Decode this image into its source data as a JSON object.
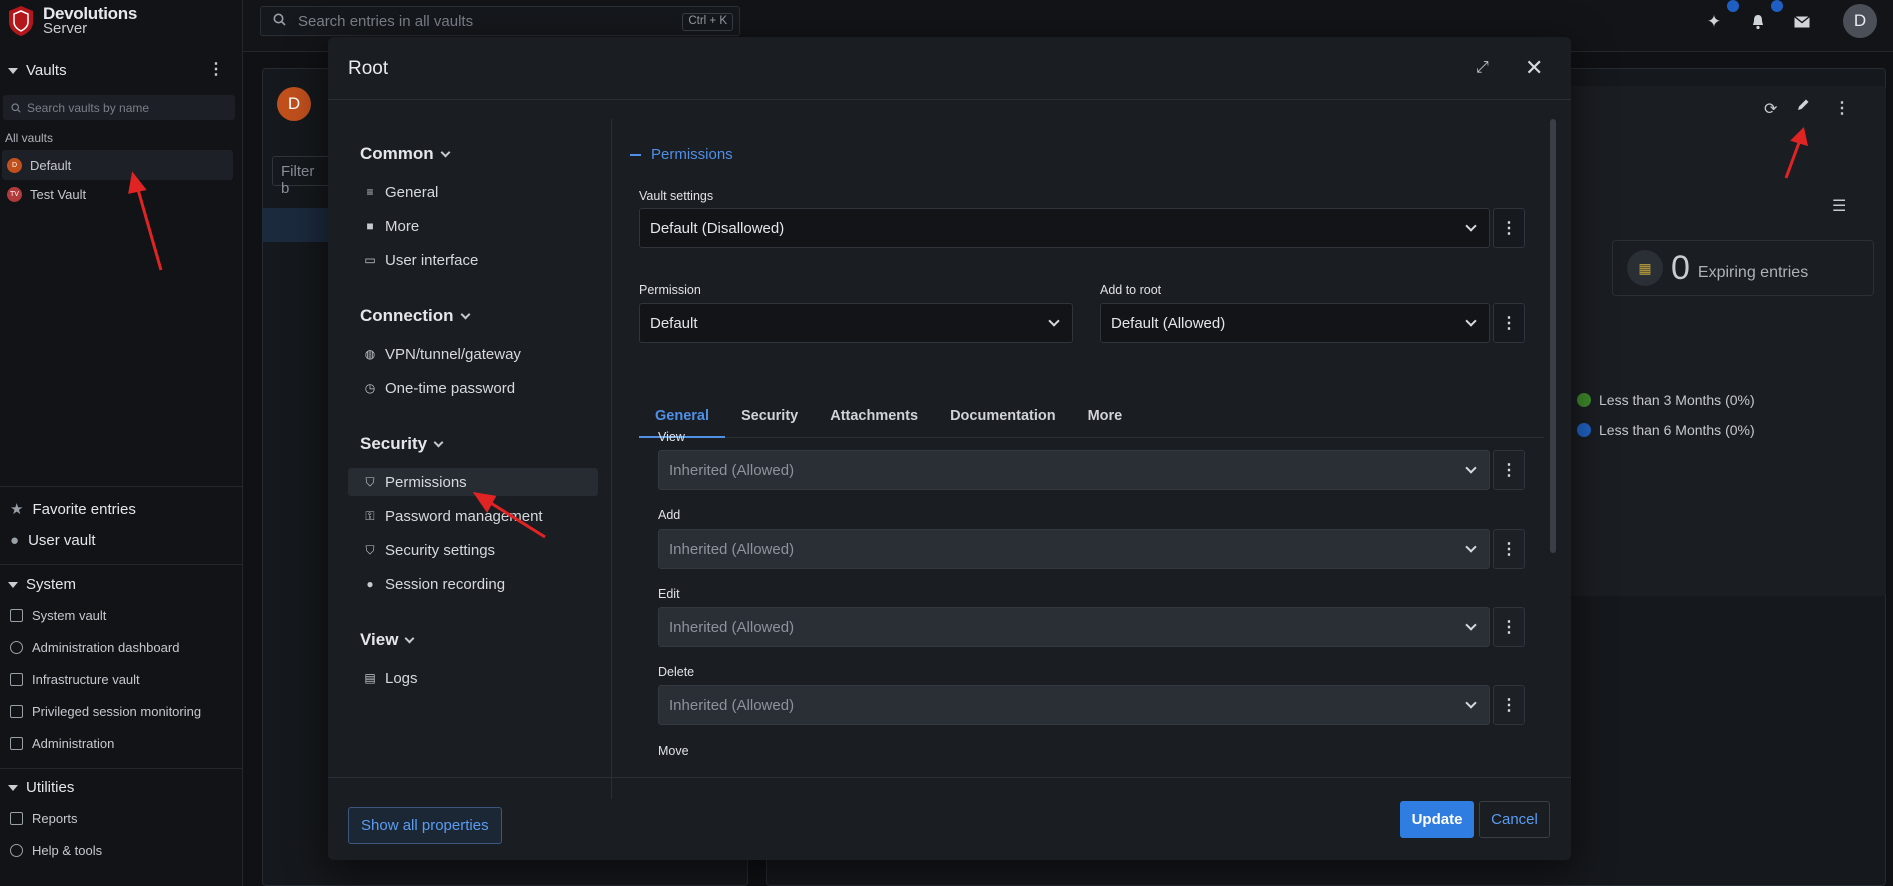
{
  "brand": {
    "line1": "Devolutions",
    "line2": "Server"
  },
  "sidebar": {
    "vaults_title": "Vaults",
    "vault_search_placeholder": "Search vaults by name",
    "all_vaults_label": "All vaults",
    "vaults": [
      {
        "label": "Default",
        "initials": "D",
        "color": "#c1501d"
      },
      {
        "label": "Test Vault",
        "initials": "TV",
        "color": "#b23a3a"
      }
    ],
    "favorite_entries": "Favorite entries",
    "user_vault": "User vault",
    "system_title": "System",
    "system_items": [
      "System vault",
      "Administration dashboard",
      "Infrastructure vault",
      "Privileged session monitoring",
      "Administration"
    ],
    "utilities_title": "Utilities",
    "utilities_items": [
      "Reports",
      "Help & tools"
    ]
  },
  "topbar": {
    "search_placeholder": "Search entries in all vaults",
    "search_shortcut": "Ctrl + K",
    "user_initial": "D"
  },
  "background": {
    "vault_avatar": "D",
    "filter_text": "Filter b",
    "expiring_count": "0",
    "expiring_label": "Expiring entries",
    "legend": [
      {
        "label": "Less than 3 Months (0%)",
        "color": "#3e8a2d"
      },
      {
        "label": "Less than 6 Months (0%)",
        "color": "#2063c4"
      }
    ]
  },
  "dialog": {
    "title": "Root",
    "nav": {
      "common_title": "Common",
      "common_items": [
        "General",
        "More",
        "User interface"
      ],
      "connection_title": "Connection",
      "connection_items": [
        "VPN/tunnel/gateway",
        "One-time password"
      ],
      "security_title": "Security",
      "security_items": [
        "Permissions",
        "Password management",
        "Security settings",
        "Session recording"
      ],
      "view_title": "View",
      "view_items": [
        "Logs"
      ]
    },
    "section_title": "Permissions",
    "vault_settings": {
      "label": "Vault settings",
      "value": "Default (Disallowed)"
    },
    "permission": {
      "label": "Permission",
      "value": "Default"
    },
    "add_to_root": {
      "label": "Add to root",
      "value": "Default (Allowed)"
    },
    "tabs": [
      "General",
      "Security",
      "Attachments",
      "Documentation",
      "More"
    ],
    "active_tab": "General",
    "rights": [
      {
        "label": "View",
        "value": "Inherited (Allowed)"
      },
      {
        "label": "Add",
        "value": "Inherited (Allowed)"
      },
      {
        "label": "Edit",
        "value": "Inherited (Allowed)"
      },
      {
        "label": "Delete",
        "value": "Inherited (Allowed)"
      },
      {
        "label": "Move",
        "value": ""
      }
    ],
    "show_all_label": "Show all properties",
    "update_label": "Update",
    "cancel_label": "Cancel"
  },
  "colors": {
    "accent": "#2f7de1",
    "link": "#4f8fe6",
    "annotation_arrow": "#e02424"
  }
}
